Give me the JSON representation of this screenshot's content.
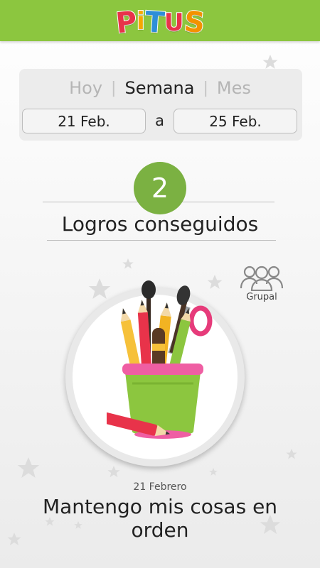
{
  "app": {
    "logo_text": "PiTUS",
    "brand_color": "#8cc63f"
  },
  "period": {
    "tabs": [
      {
        "label": "Hoy",
        "active": false
      },
      {
        "label": "Semana",
        "active": true
      },
      {
        "label": "Mes",
        "active": false
      }
    ],
    "separator": "|",
    "from": "21 Feb.",
    "connector": "a",
    "to": "25 Feb."
  },
  "achievements": {
    "count": "2",
    "label": "Logros conseguidos",
    "accent": "#7bb142"
  },
  "group": {
    "icon": "group-icon",
    "label": "Grupal"
  },
  "item": {
    "illustration": "pencil-cup-icon",
    "date": "21 Febrero",
    "title": "Mantengo mis cosas en orden"
  }
}
